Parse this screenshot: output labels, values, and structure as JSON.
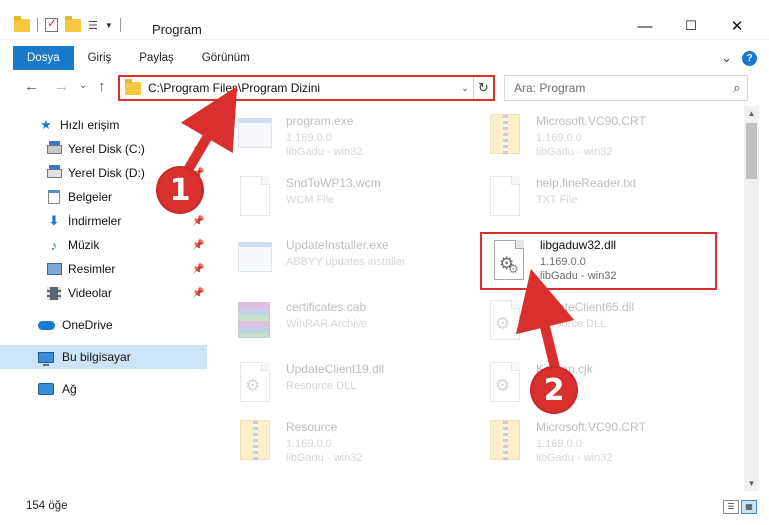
{
  "window": {
    "title": "Program",
    "minimize": "—",
    "maximize": "☐",
    "close": "✕"
  },
  "ribbon": {
    "tabs": [
      "Dosya",
      "Giriş",
      "Paylaş",
      "Görünüm"
    ],
    "expand": "⌄",
    "help": "?"
  },
  "nav": {
    "back": "←",
    "forward": "→",
    "recent": "⌄",
    "up": "↑",
    "address": "C:\\Program Files\\Program Dizini",
    "address_dropdown": "⌄",
    "refresh": "↻",
    "search_placeholder": "Ara: Program",
    "search_icon": "⌕"
  },
  "sidebar": {
    "items": [
      {
        "label": "Hızlı erişim",
        "icon": "star-icon"
      },
      {
        "label": "Yerel Disk (C:)",
        "icon": "drive-icon",
        "pinned": true
      },
      {
        "label": "Yerel Disk (D:)",
        "icon": "drive-icon",
        "pinned": true
      },
      {
        "label": "Belgeler",
        "icon": "documents-icon",
        "pinned": true
      },
      {
        "label": "İndirmeler",
        "icon": "download-icon",
        "pinned": true
      },
      {
        "label": "Müzik",
        "icon": "music-icon",
        "pinned": true
      },
      {
        "label": "Resimler",
        "icon": "pictures-icon",
        "pinned": true
      },
      {
        "label": "Videolar",
        "icon": "videos-icon",
        "pinned": true
      },
      {
        "label": "OneDrive",
        "icon": "onedrive-icon"
      },
      {
        "label": "Bu bilgisayar",
        "icon": "computer-icon",
        "selected": true
      },
      {
        "label": "Ağ",
        "icon": "network-icon"
      }
    ],
    "pin_glyph": "📌"
  },
  "files": [
    {
      "name": "program.exe",
      "line1": "1.169.0.0",
      "line2": "libGadu - win32",
      "icon": "exe-icon"
    },
    {
      "name": "Microsoft.VC90.CRT",
      "line1": "1.169.0.0",
      "line2": "libGadu - win32",
      "icon": "zip-folder-icon"
    },
    {
      "name": "SndToWP13.wcm",
      "line1": "WCM File",
      "line2": "",
      "icon": "generic-file-icon"
    },
    {
      "name": "help.fineReader.txt",
      "line1": "TXT File",
      "line2": "",
      "icon": "generic-file-icon"
    },
    {
      "name": "UpdateInstaller.exe",
      "line1": "ABBYY updates installer",
      "line2": "",
      "icon": "exe-icon"
    },
    {
      "name": "libgaduw32.dll",
      "line1": "1.169.0.0",
      "line2": "libGadu - win32",
      "icon": "dll-gear-icon",
      "highlight": true
    },
    {
      "name": "certificates.cab",
      "line1": "WinRAR Archive",
      "line2": "",
      "icon": "cab-icon"
    },
    {
      "name": "UpdateClient65.dll",
      "line1": "Resource DLL",
      "line2": "",
      "icon": "dll-gear-icon"
    },
    {
      "name": "UpdateClient19.dll",
      "line1": "Resource DLL",
      "line2": "",
      "icon": "dll-gear-icon"
    },
    {
      "name": "Korean.cjk",
      "line1": "CJK File",
      "line2": "",
      "icon": "dll-gear-icon"
    },
    {
      "name": "Resource",
      "line1": "1.169.0.0",
      "line2": "libGadu - win32",
      "icon": "zip-folder-icon"
    },
    {
      "name": "Microsoft.VC90.CRT",
      "line1": "1.169.0.0",
      "line2": "libGadu - win32",
      "icon": "zip-folder-icon"
    }
  ],
  "status": {
    "count": "154 öğe"
  },
  "scroll": {
    "up": "▲",
    "down": "▼"
  },
  "annotations": {
    "badge1": "1",
    "badge2": "2",
    "color": "#d9302f"
  },
  "colors": {
    "accent": "#1979ca",
    "selection": "#cce4f7",
    "highlight": "#d9302f"
  }
}
